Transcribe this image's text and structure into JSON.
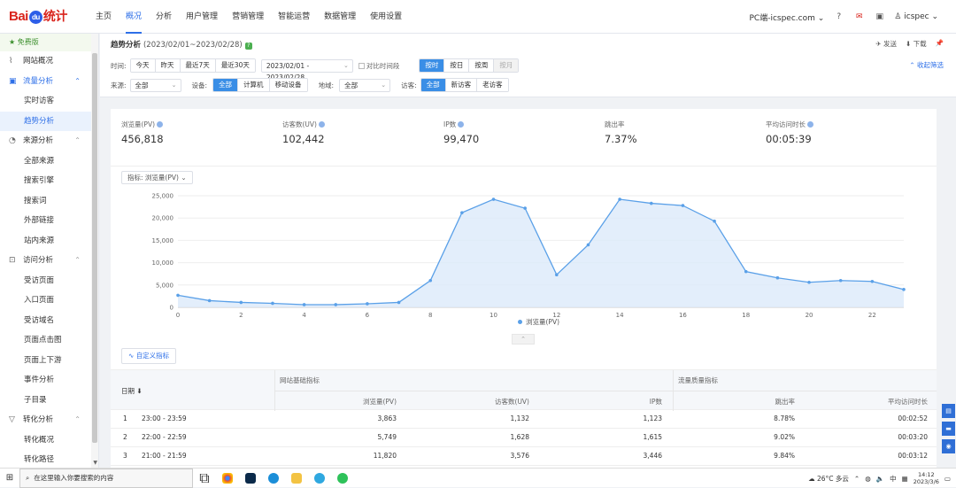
{
  "brand": {
    "logo_left": "Bai",
    "logo_paw": "du",
    "logo_right": "统计"
  },
  "nav": {
    "items": [
      "主页",
      "概况",
      "分析",
      "用户管理",
      "营销管理",
      "智能运营",
      "数据管理",
      "使用设置"
    ],
    "active_index": 1
  },
  "topright": {
    "site": "PC端-icspec.com",
    "user": "icspec"
  },
  "sidebar": {
    "free": "免费版",
    "items": [
      {
        "label": "网站概况",
        "kind": "grp",
        "icon": "chart-icon"
      },
      {
        "label": "流量分析",
        "kind": "grp",
        "open": true,
        "icon": "monitor-icon"
      },
      {
        "label": "实时访客",
        "kind": "sub"
      },
      {
        "label": "趋势分析",
        "kind": "sub",
        "selected": true
      },
      {
        "label": "来源分析",
        "kind": "grp",
        "icon": "source-icon"
      },
      {
        "label": "全部来源",
        "kind": "sub"
      },
      {
        "label": "搜索引擎",
        "kind": "sub"
      },
      {
        "label": "搜索词",
        "kind": "sub"
      },
      {
        "label": "外部链接",
        "kind": "sub"
      },
      {
        "label": "站内来源",
        "kind": "sub"
      },
      {
        "label": "访问分析",
        "kind": "grp",
        "icon": "visit-icon"
      },
      {
        "label": "受访页面",
        "kind": "sub"
      },
      {
        "label": "入口页面",
        "kind": "sub"
      },
      {
        "label": "受访域名",
        "kind": "sub"
      },
      {
        "label": "页面点击图",
        "kind": "sub"
      },
      {
        "label": "页面上下游",
        "kind": "sub"
      },
      {
        "label": "事件分析",
        "kind": "sub"
      },
      {
        "label": "子目录",
        "kind": "sub"
      },
      {
        "label": "转化分析",
        "kind": "grp",
        "icon": "funnel-icon"
      },
      {
        "label": "转化概况",
        "kind": "sub"
      },
      {
        "label": "转化路径",
        "kind": "sub"
      }
    ]
  },
  "page": {
    "title": "趋势分析",
    "range": "(2023/02/01~2023/02/28)",
    "send": "发送",
    "download": "下载",
    "collapse": "收起筛选"
  },
  "filters": {
    "time_label": "时间:",
    "time_opts": [
      "今天",
      "昨天",
      "最近7天",
      "最近30天"
    ],
    "date_range": "2023/02/01 - 2023/02/28",
    "compare": "对比时间段",
    "gran_opts": [
      "按时",
      "按日",
      "按周",
      "按月"
    ],
    "gran_active": 0,
    "source_label": "来源:",
    "source_val": "全部",
    "device_label": "设备:",
    "device_opts": [
      "全部",
      "计算机",
      "移动设备"
    ],
    "region_label": "地域:",
    "region_val": "全部",
    "visitor_label": "访客:",
    "visitor_opts": [
      "全部",
      "新访客",
      "老访客"
    ]
  },
  "kpis": [
    {
      "label": "浏览量(PV)",
      "value": "456,818"
    },
    {
      "label": "访客数(UV)",
      "value": "102,442"
    },
    {
      "label": "IP数",
      "value": "99,470"
    },
    {
      "label": "跳出率",
      "value": "7.37%"
    },
    {
      "label": "平均访问时长",
      "value": "00:05:39"
    }
  ],
  "metric": {
    "label": "指标:",
    "value": "浏览量(PV)"
  },
  "custom_btn": "自定义指标",
  "chart_data": {
    "type": "line",
    "x": [
      0,
      1,
      2,
      3,
      4,
      5,
      6,
      7,
      8,
      9,
      10,
      11,
      12,
      13,
      14,
      15,
      16,
      17,
      18,
      19,
      20,
      21,
      22,
      23
    ],
    "series": [
      {
        "name": "浏览量(PV)",
        "values": [
          2700,
          1500,
          1100,
          900,
          600,
          600,
          800,
          1100,
          6000,
          21200,
          24200,
          22200,
          7300,
          14000,
          24200,
          23300,
          22800,
          19300,
          8000,
          6600,
          5600,
          6000,
          5800,
          4000
        ],
        "color": "#5aa0e8"
      }
    ],
    "xticks": [
      0,
      2,
      4,
      6,
      8,
      10,
      12,
      14,
      16,
      18,
      20,
      22
    ],
    "yticks": [
      "0",
      "5,000",
      "10,000",
      "15,000",
      "20,000",
      "25,000"
    ],
    "ylim": [
      0,
      25000
    ],
    "grid": true,
    "legend": "bottom"
  },
  "table": {
    "date_col": "日期",
    "group1": "网站基础指标",
    "group2": "流量质量指标",
    "cols": [
      "浏览量(PV)",
      "访客数(UV)",
      "IP数",
      "跳出率",
      "平均访问时长"
    ],
    "rows": [
      {
        "idx": "1",
        "time": "23:00 - 23:59",
        "pv": "3,863",
        "uv": "1,132",
        "ip": "1,123",
        "bounce": "8.78%",
        "dur": "00:02:52"
      },
      {
        "idx": "2",
        "time": "22:00 - 22:59",
        "pv": "5,749",
        "uv": "1,628",
        "ip": "1,615",
        "bounce": "9.02%",
        "dur": "00:03:20"
      },
      {
        "idx": "3",
        "time": "21:00 - 21:59",
        "pv": "11,820",
        "uv": "3,576",
        "ip": "3,446",
        "bounce": "9.84%",
        "dur": "00:03:12"
      }
    ]
  },
  "taskbar": {
    "search": "在这里输入你要搜索的内容",
    "weather": "26°C 多云",
    "ime": "中",
    "time": "14:12",
    "date": "2023/3/6"
  }
}
